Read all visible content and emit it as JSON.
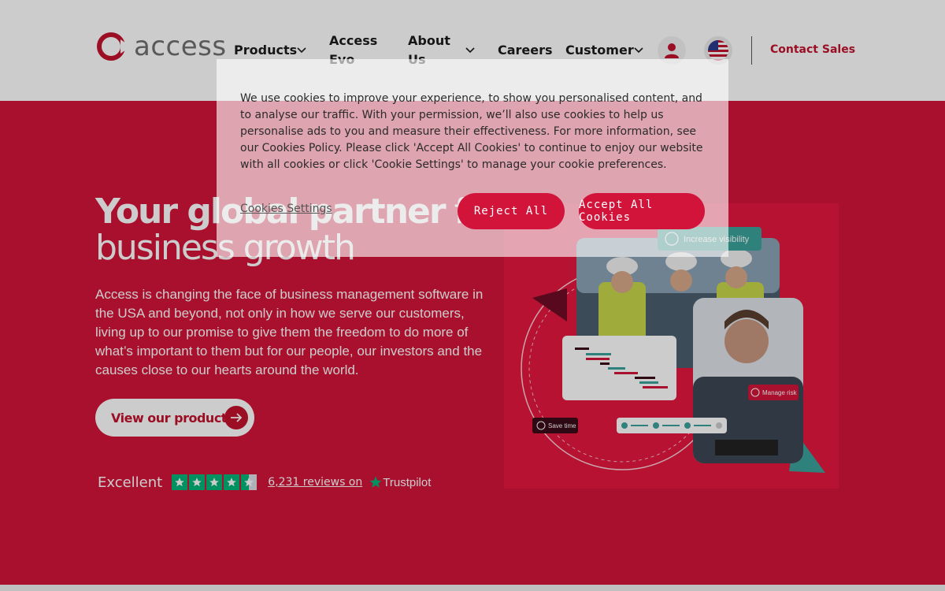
{
  "header": {
    "logo_text": "access",
    "nav": [
      {
        "label": "Products",
        "has_dropdown": true
      },
      {
        "label": "Access Evo",
        "has_dropdown": false
      },
      {
        "label": "About Us",
        "has_dropdown": true
      },
      {
        "label": "Careers",
        "has_dropdown": false
      },
      {
        "label": "Customer",
        "has_dropdown": true
      }
    ],
    "user_icon": "user-icon",
    "flag_icon": "us-flag-icon",
    "contact_label": "Contact Sales"
  },
  "hero": {
    "headline_bold": "Your global partner",
    "headline_light_1": "for",
    "headline_light_2": "business growth",
    "subtext": "Access is changing the face of business management software in the USA and beyond, not only in how we serve our customers, living up to our promise to give them the freedom to do more of what’s important to them but for our people, our investors and the causes close to our hearts around the world.",
    "cta_label": "View our products",
    "trustpilot": {
      "rating_label": "Excellent",
      "stars": 4.5,
      "reviews_label": "6,231 reviews on",
      "brand": "Trustpilot"
    },
    "illustration": {
      "tag_visibility": "Increase visibility",
      "tag_risk": "Manage risk",
      "tag_time": "Save time"
    }
  },
  "cookie_banner": {
    "text": "We use cookies to improve your experience, to show you personalised content, and to analyse our traffic. With your permission, we’ll also use cookies to help us personalise ads to you and measure their effectiveness. For more information, see our Cookies Policy. Please click 'Accept All Cookies' to continue to enjoy our website with all cookies or click 'Cookie Settings' to manage your cookie preferences.",
    "settings_label": "Cookies Settings",
    "reject_label": "Reject All",
    "accept_label": "Accept All Cookies"
  },
  "colors": {
    "brand_red": "#d2143a",
    "trustpilot_green": "#00b67a",
    "teal": "#3aa39a"
  }
}
